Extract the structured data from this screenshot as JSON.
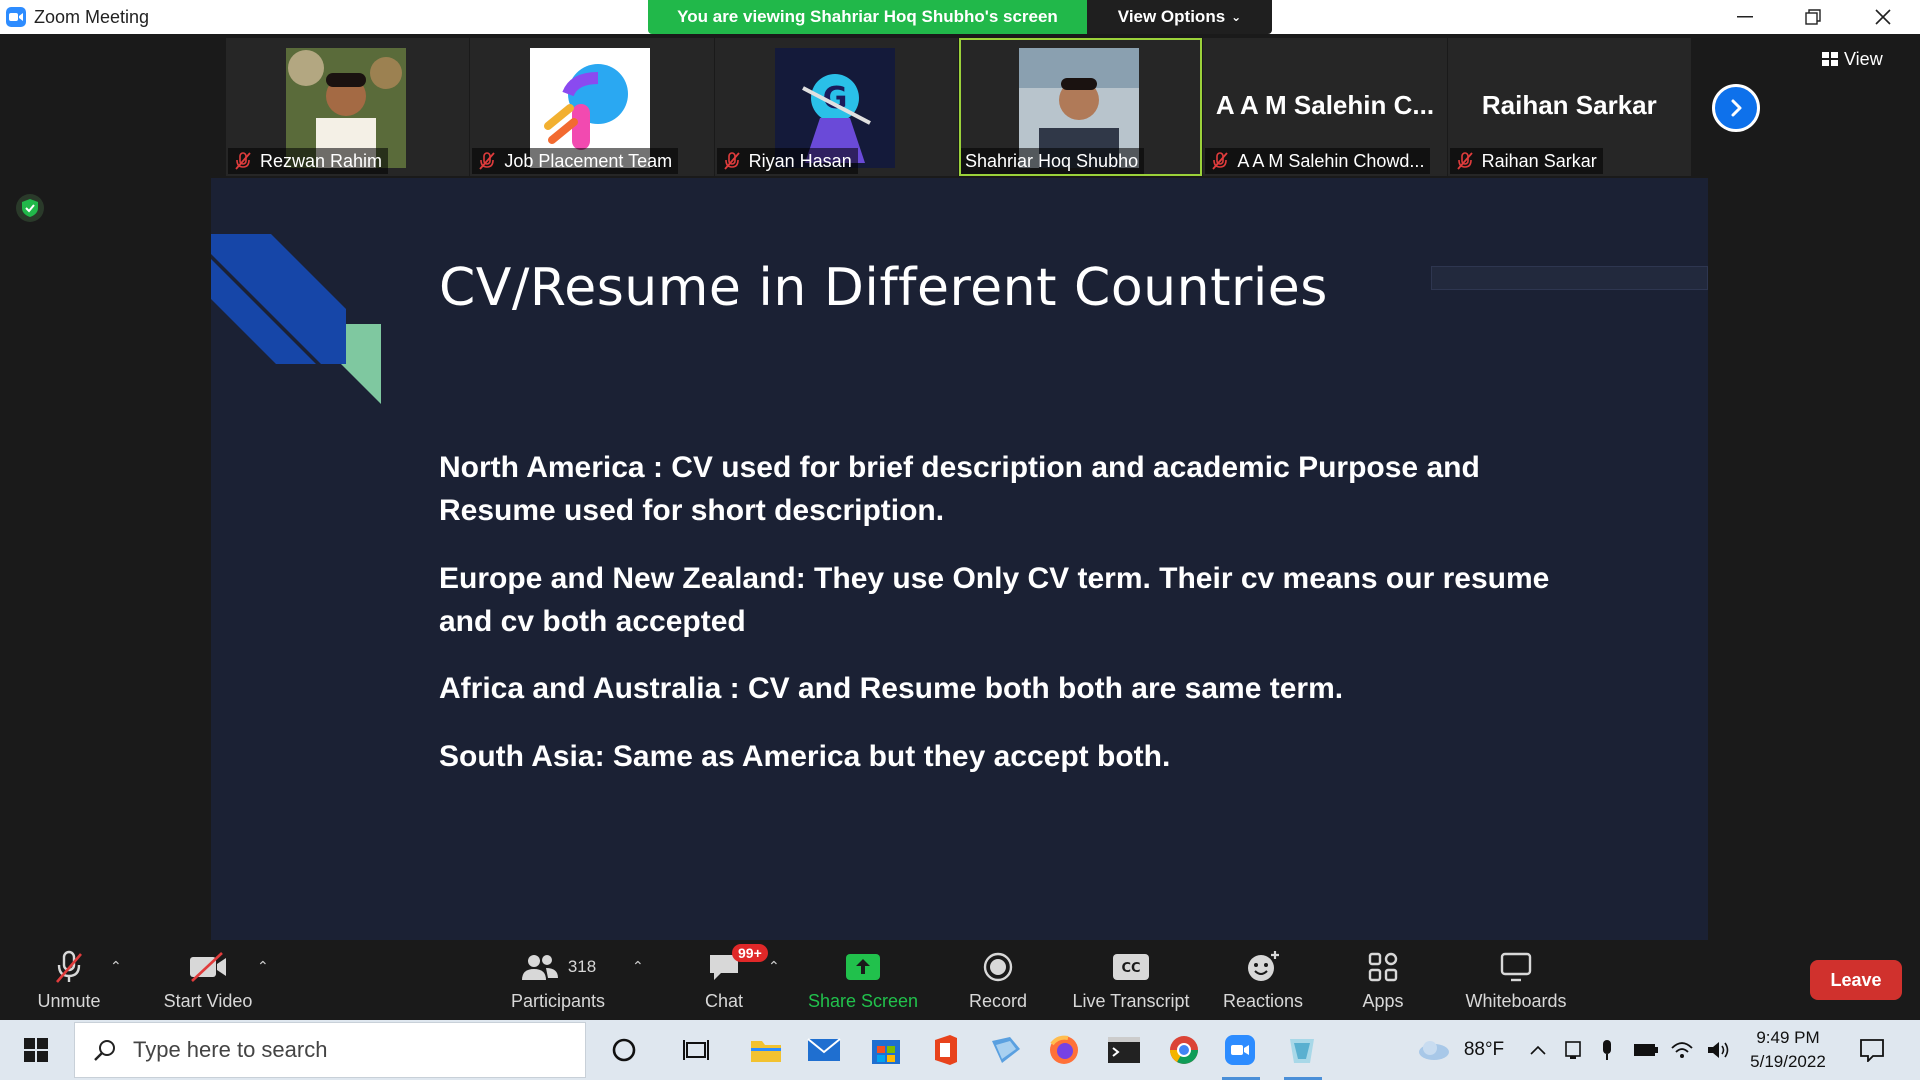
{
  "window": {
    "title": "Zoom Meeting"
  },
  "banner": {
    "text": "You are viewing Shahriar Hoq Shubho's screen",
    "view_options": "View Options"
  },
  "gallery": {
    "participants": [
      {
        "name": "Rezwan Rahim",
        "muted": true,
        "has_photo": true
      },
      {
        "name": "Job Placement Team",
        "muted": true,
        "has_photo": true
      },
      {
        "name": "Riyan Hasan",
        "muted": true,
        "has_photo": true
      },
      {
        "name": "Shahriar Hoq Shubho",
        "muted": false,
        "has_photo": true,
        "active": true
      },
      {
        "name": "A A M Salehin Chowd...",
        "display_big": "A A M Salehin C...",
        "muted": true,
        "has_photo": false
      },
      {
        "name": "Raihan Sarkar",
        "display_big": "Raihan Sarkar",
        "muted": true,
        "has_photo": false
      }
    ],
    "view_label": "View"
  },
  "slide": {
    "title": "CV/Resume in Different Countries",
    "paragraphs": [
      "North America : CV used for brief description and academic Purpose and Resume used  for short description.",
      "Europe and New Zealand: They use Only CV term. Their cv means our resume and cv both accepted",
      "Africa and Australia :  CV and Resume both both are same term.",
      "South Asia: Same  as America but they accept both."
    ],
    "accent_colors": {
      "blue": "#1646a8",
      "green": "#7fc8a0",
      "background": "#1b2134"
    }
  },
  "toolbar": {
    "unmute": "Unmute",
    "start_video": "Start Video",
    "participants": "Participants",
    "participants_count": "318",
    "chat": "Chat",
    "chat_badge": "99+",
    "share_screen": "Share Screen",
    "record": "Record",
    "live_transcript": "Live Transcript",
    "reactions": "Reactions",
    "apps": "Apps",
    "whiteboards": "Whiteboards",
    "leave": "Leave"
  },
  "taskbar": {
    "search_placeholder": "Type here to search",
    "temperature": "88°F",
    "time": "9:49 PM",
    "date": "5/19/2022"
  }
}
